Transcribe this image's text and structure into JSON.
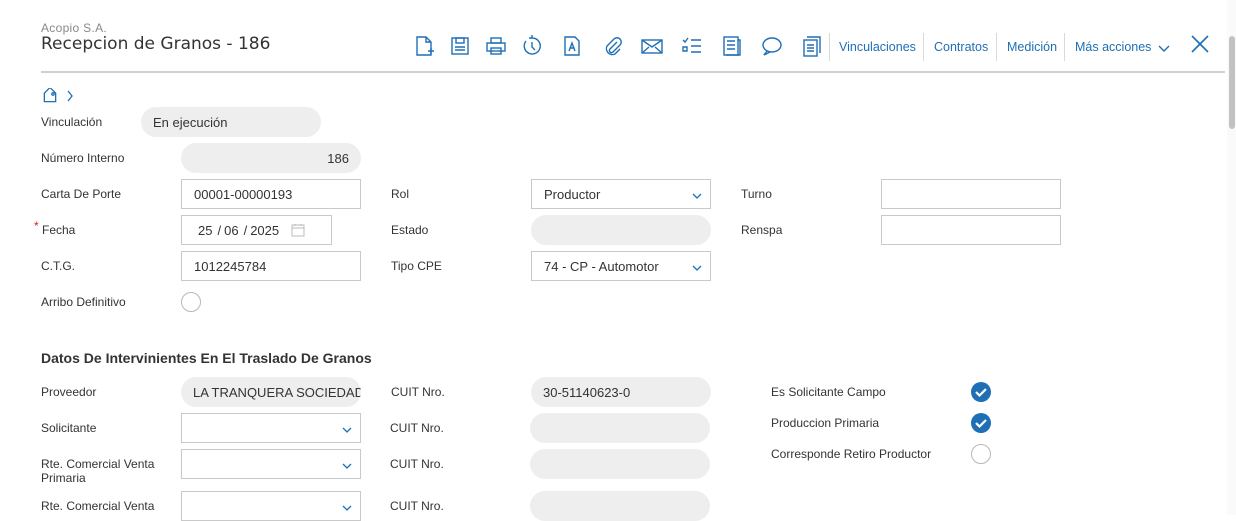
{
  "header": {
    "company": "Acopio S.A.",
    "title": "Recepcion de Granos - 186",
    "links": {
      "vinculaciones": "Vinculaciones",
      "contratos": "Contratos",
      "medicion": "Medición",
      "mas_acciones": "Más acciones"
    }
  },
  "icons": {
    "toolbar": [
      "new-document-icon",
      "save-icon",
      "print-icon",
      "history-icon",
      "text-document-icon",
      "attachment-icon",
      "email-icon",
      "checklist-icon",
      "notes-icon",
      "comment-icon",
      "copy-icon"
    ],
    "close": "close-icon",
    "tag": "tag-icon"
  },
  "colors": {
    "accent": "#1e6fb5",
    "required": "#d9201c"
  },
  "form": {
    "vinculacion": {
      "label": "Vinculación",
      "value": "En ejecución"
    },
    "numero_interno": {
      "label": "Número Interno",
      "value": "186"
    },
    "carta_porte": {
      "label": "Carta De Porte",
      "value": "00001-00000193"
    },
    "fecha": {
      "label": "Fecha",
      "required_mark": "*",
      "day": "25",
      "month": "06",
      "year": "2025",
      "sep": "/"
    },
    "ctg": {
      "label": "C.T.G.",
      "value": "1012245784"
    },
    "arribo_definitivo": {
      "label": "Arribo Definitivo",
      "checked": false
    },
    "rol": {
      "label": "Rol",
      "value": "Productor"
    },
    "estado": {
      "label": "Estado",
      "value": ""
    },
    "tipo_cpe": {
      "label": "Tipo CPE",
      "value": "74 - CP - Automotor"
    },
    "turno": {
      "label": "Turno",
      "value": ""
    },
    "renspa": {
      "label": "Renspa",
      "value": ""
    }
  },
  "intervinientes": {
    "title": "Datos De Intervinientes En El Traslado De Granos",
    "proveedor": {
      "label": "Proveedor",
      "value": "LA TRANQUERA SOCIEDAD"
    },
    "solicitante": {
      "label": "Solicitante",
      "value": ""
    },
    "rte_primaria": {
      "label": "Rte. Comercial Venta Primaria",
      "value": ""
    },
    "rte_secundaria": {
      "label": "Rte. Comercial Venta",
      "value": ""
    },
    "cuit_label": "CUIT Nro.",
    "cuit_proveedor": "30-51140623-0",
    "es_solicitante_campo": {
      "label": "Es Solicitante Campo",
      "checked": true
    },
    "produccion_primaria": {
      "label": "Produccion Primaria",
      "checked": true
    },
    "corresponde_retiro": {
      "label": "Corresponde Retiro Productor",
      "checked": false
    }
  }
}
